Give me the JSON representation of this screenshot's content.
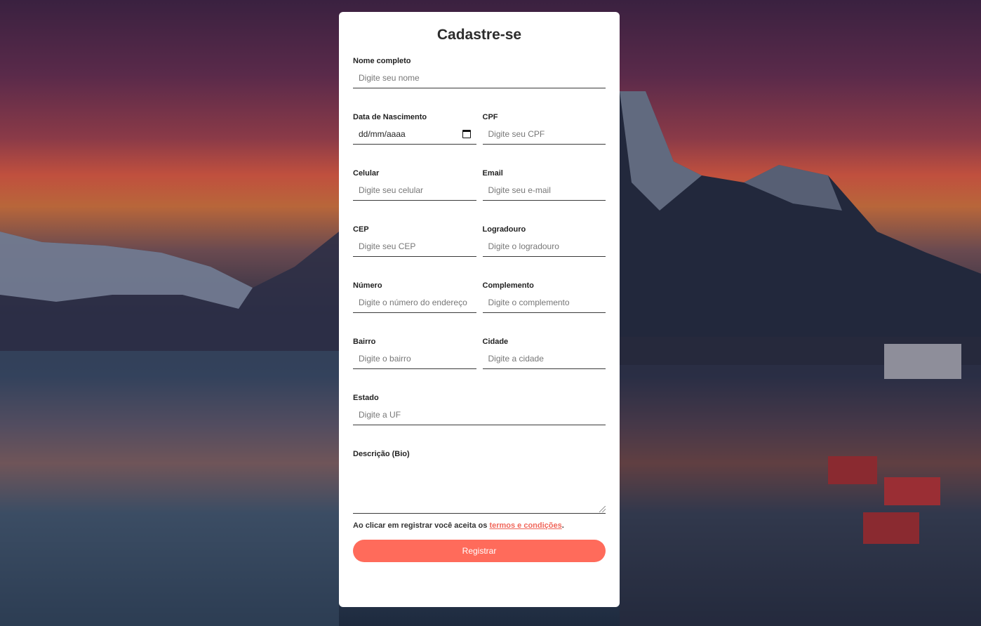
{
  "form": {
    "title": "Cadastre-se",
    "fields": {
      "nome": {
        "label": "Nome completo",
        "placeholder": "Digite seu nome"
      },
      "nascimento": {
        "label": "Data de Nascimento",
        "value": "dd/mm/aaaa"
      },
      "cpf": {
        "label": "CPF",
        "placeholder": "Digite seu CPF"
      },
      "celular": {
        "label": "Celular",
        "placeholder": "Digite seu celular"
      },
      "email": {
        "label": "Email",
        "placeholder": "Digite seu e-mail"
      },
      "cep": {
        "label": "CEP",
        "placeholder": "Digite seu CEP"
      },
      "logradouro": {
        "label": "Logradouro",
        "placeholder": "Digite o logradouro"
      },
      "numero": {
        "label": "Número",
        "placeholder": "Digite o número do endereço"
      },
      "complemento": {
        "label": "Complemento",
        "placeholder": "Digite o complemento"
      },
      "bairro": {
        "label": "Bairro",
        "placeholder": "Digite o bairro"
      },
      "cidade": {
        "label": "Cidade",
        "placeholder": "Digite a cidade"
      },
      "estado": {
        "label": "Estado",
        "placeholder": "Digite a UF"
      },
      "bio": {
        "label": "Descrição (Bio)"
      }
    },
    "terms": {
      "prefix": "Ao clicar em registrar você aceita os ",
      "link": "termos e condições",
      "suffix": "."
    },
    "submit_label": "Registrar"
  },
  "colors": {
    "accent": "#ff6b5b",
    "card": "#ffffff"
  }
}
